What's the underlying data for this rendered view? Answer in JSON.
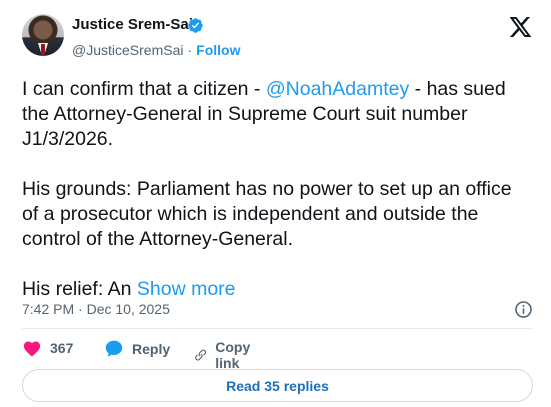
{
  "author": {
    "name": "Justice Srem-Sai",
    "handle": "@JusticeSremSai",
    "dot": "·",
    "follow_label": "Follow"
  },
  "tweet": {
    "para1_before": "I can confirm that a citizen - ",
    "mention": "@NoahAdamtey",
    "para1_after": " - has sued the Attorney-General in Supreme Court suit number J1/3/2026.",
    "para2": "His grounds: Parliament has no power to set up an office of a prosecutor which is independent and outside the control of the Attorney-General.",
    "para3": "His relief: An ",
    "show_more": "Show more",
    "timestamp": "7:42 PM · Dec 10, 2025"
  },
  "actions": {
    "like_count": "367",
    "reply_label": "Reply",
    "copy_label": "Copy link"
  },
  "replies_button": "Read 35 replies",
  "colors": {
    "accent": "#1d9bf0",
    "like": "#f91880",
    "text": "#0f1419",
    "muted": "#536471"
  }
}
